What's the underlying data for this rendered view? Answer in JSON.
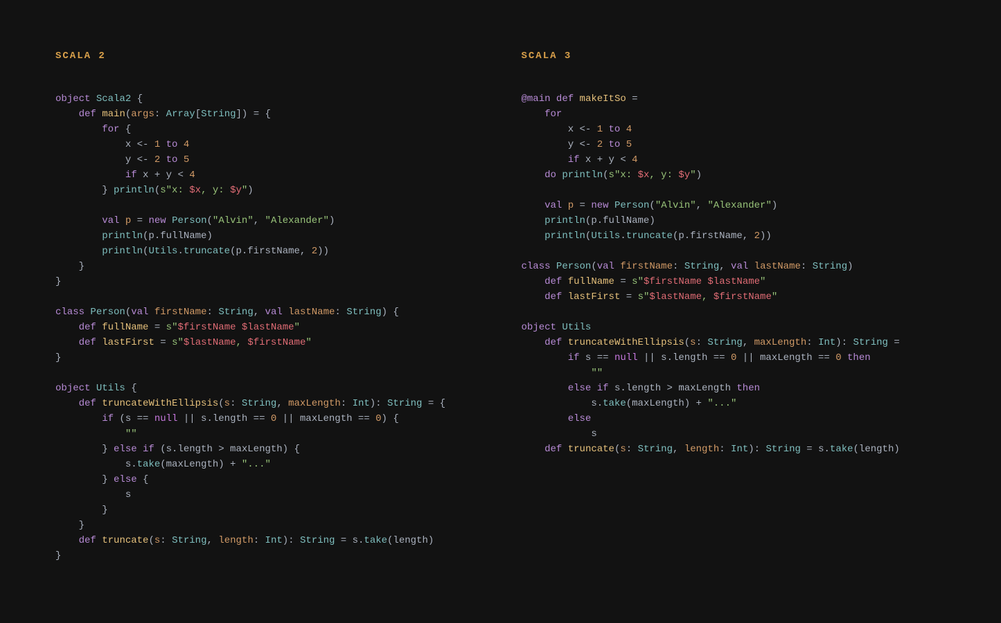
{
  "left": {
    "title": "SCALA 2",
    "tokens": [
      [
        [
          "kw",
          "object"
        ],
        [
          "plain",
          " "
        ],
        [
          "type",
          "Scala2"
        ],
        [
          "plain",
          " {"
        ]
      ],
      [
        [
          "plain",
          "    "
        ],
        [
          "kw",
          "def"
        ],
        [
          "plain",
          " "
        ],
        [
          "fn",
          "main"
        ],
        [
          "plain",
          "("
        ],
        [
          "id",
          "args"
        ],
        [
          "plain",
          ": "
        ],
        [
          "type",
          "Array"
        ],
        [
          "plain",
          "["
        ],
        [
          "type",
          "String"
        ],
        [
          "plain",
          "]) = {"
        ]
      ],
      [
        [
          "plain",
          "        "
        ],
        [
          "kw",
          "for"
        ],
        [
          "plain",
          " {"
        ]
      ],
      [
        [
          "plain",
          "            "
        ],
        [
          "plain",
          "x <- "
        ],
        [
          "num",
          "1"
        ],
        [
          "plain",
          " "
        ],
        [
          "kw",
          "to"
        ],
        [
          "plain",
          " "
        ],
        [
          "num",
          "4"
        ]
      ],
      [
        [
          "plain",
          "            "
        ],
        [
          "plain",
          "y <- "
        ],
        [
          "num",
          "2"
        ],
        [
          "plain",
          " "
        ],
        [
          "kw",
          "to"
        ],
        [
          "plain",
          " "
        ],
        [
          "num",
          "5"
        ]
      ],
      [
        [
          "plain",
          "            "
        ],
        [
          "kw",
          "if"
        ],
        [
          "plain",
          " x + y < "
        ],
        [
          "num",
          "4"
        ]
      ],
      [
        [
          "plain",
          "        } "
        ],
        [
          "call",
          "println"
        ],
        [
          "plain",
          "("
        ],
        [
          "str",
          "s\"x: "
        ],
        [
          "interp",
          "$x"
        ],
        [
          "str",
          ", y: "
        ],
        [
          "interp",
          "$y"
        ],
        [
          "str",
          "\""
        ],
        [
          "plain",
          ")"
        ]
      ],
      [
        [
          "plain",
          ""
        ]
      ],
      [
        [
          "plain",
          "        "
        ],
        [
          "kw",
          "val"
        ],
        [
          "plain",
          " "
        ],
        [
          "id",
          "p"
        ],
        [
          "plain",
          " = "
        ],
        [
          "kw",
          "new"
        ],
        [
          "plain",
          " "
        ],
        [
          "type",
          "Person"
        ],
        [
          "plain",
          "("
        ],
        [
          "str",
          "\"Alvin\""
        ],
        [
          "plain",
          ", "
        ],
        [
          "str",
          "\"Alexander\""
        ],
        [
          "plain",
          ")"
        ]
      ],
      [
        [
          "plain",
          "        "
        ],
        [
          "call",
          "println"
        ],
        [
          "plain",
          "(p.fullName)"
        ]
      ],
      [
        [
          "plain",
          "        "
        ],
        [
          "call",
          "println"
        ],
        [
          "plain",
          "("
        ],
        [
          "type",
          "Utils"
        ],
        [
          "plain",
          "."
        ],
        [
          "call",
          "truncate"
        ],
        [
          "plain",
          "(p.firstName, "
        ],
        [
          "num",
          "2"
        ],
        [
          "plain",
          "))"
        ]
      ],
      [
        [
          "plain",
          "    }"
        ]
      ],
      [
        [
          "plain",
          "}"
        ]
      ],
      [
        [
          "plain",
          ""
        ]
      ],
      [
        [
          "kw",
          "class"
        ],
        [
          "plain",
          " "
        ],
        [
          "type",
          "Person"
        ],
        [
          "plain",
          "("
        ],
        [
          "kw",
          "val"
        ],
        [
          "plain",
          " "
        ],
        [
          "id",
          "firstName"
        ],
        [
          "plain",
          ": "
        ],
        [
          "type",
          "String"
        ],
        [
          "plain",
          ", "
        ],
        [
          "kw",
          "val"
        ],
        [
          "plain",
          " "
        ],
        [
          "id",
          "lastName"
        ],
        [
          "plain",
          ": "
        ],
        [
          "type",
          "String"
        ],
        [
          "plain",
          ") {"
        ]
      ],
      [
        [
          "plain",
          "    "
        ],
        [
          "kw",
          "def"
        ],
        [
          "plain",
          " "
        ],
        [
          "fn",
          "fullName"
        ],
        [
          "plain",
          " = "
        ],
        [
          "str",
          "s\""
        ],
        [
          "interp",
          "$firstName"
        ],
        [
          "str",
          " "
        ],
        [
          "interp",
          "$lastName"
        ],
        [
          "str",
          "\""
        ]
      ],
      [
        [
          "plain",
          "    "
        ],
        [
          "kw",
          "def"
        ],
        [
          "plain",
          " "
        ],
        [
          "fn",
          "lastFirst"
        ],
        [
          "plain",
          " = "
        ],
        [
          "str",
          "s\""
        ],
        [
          "interp",
          "$lastName"
        ],
        [
          "str",
          ", "
        ],
        [
          "interp",
          "$firstName"
        ],
        [
          "str",
          "\""
        ]
      ],
      [
        [
          "plain",
          "}"
        ]
      ],
      [
        [
          "plain",
          ""
        ]
      ],
      [
        [
          "kw",
          "object"
        ],
        [
          "plain",
          " "
        ],
        [
          "type",
          "Utils"
        ],
        [
          "plain",
          " {"
        ]
      ],
      [
        [
          "plain",
          "    "
        ],
        [
          "kw",
          "def"
        ],
        [
          "plain",
          " "
        ],
        [
          "fn",
          "truncateWithEllipsis"
        ],
        [
          "plain",
          "("
        ],
        [
          "id",
          "s"
        ],
        [
          "plain",
          ": "
        ],
        [
          "type",
          "String"
        ],
        [
          "plain",
          ", "
        ],
        [
          "id",
          "maxLength"
        ],
        [
          "plain",
          ": "
        ],
        [
          "type",
          "Int"
        ],
        [
          "plain",
          "): "
        ],
        [
          "type",
          "String"
        ],
        [
          "plain",
          " = {"
        ]
      ],
      [
        [
          "plain",
          "        "
        ],
        [
          "kw",
          "if"
        ],
        [
          "plain",
          " (s == "
        ],
        [
          "nl",
          "null"
        ],
        [
          "plain",
          " || s.length == "
        ],
        [
          "num",
          "0"
        ],
        [
          "plain",
          " || maxLength == "
        ],
        [
          "num",
          "0"
        ],
        [
          "plain",
          ") {"
        ]
      ],
      [
        [
          "plain",
          "            "
        ],
        [
          "str",
          "\"\""
        ]
      ],
      [
        [
          "plain",
          "        } "
        ],
        [
          "kw",
          "else"
        ],
        [
          "plain",
          " "
        ],
        [
          "kw",
          "if"
        ],
        [
          "plain",
          " (s.length > maxLength) {"
        ]
      ],
      [
        [
          "plain",
          "            s."
        ],
        [
          "call",
          "take"
        ],
        [
          "plain",
          "(maxLength) + "
        ],
        [
          "str",
          "\"...\""
        ]
      ],
      [
        [
          "plain",
          "        } "
        ],
        [
          "kw",
          "else"
        ],
        [
          "plain",
          " {"
        ]
      ],
      [
        [
          "plain",
          "            s"
        ]
      ],
      [
        [
          "plain",
          "        }"
        ]
      ],
      [
        [
          "plain",
          "    }"
        ]
      ],
      [
        [
          "plain",
          "    "
        ],
        [
          "kw",
          "def"
        ],
        [
          "plain",
          " "
        ],
        [
          "fn",
          "truncate"
        ],
        [
          "plain",
          "("
        ],
        [
          "id",
          "s"
        ],
        [
          "plain",
          ": "
        ],
        [
          "type",
          "String"
        ],
        [
          "plain",
          ", "
        ],
        [
          "id",
          "length"
        ],
        [
          "plain",
          ": "
        ],
        [
          "type",
          "Int"
        ],
        [
          "plain",
          "): "
        ],
        [
          "type",
          "String"
        ],
        [
          "plain",
          " = s."
        ],
        [
          "call",
          "take"
        ],
        [
          "plain",
          "(length)"
        ]
      ],
      [
        [
          "plain",
          "}"
        ]
      ]
    ]
  },
  "right": {
    "title": "SCALA 3",
    "tokens": [
      [
        [
          "kw",
          "@main"
        ],
        [
          "plain",
          " "
        ],
        [
          "kw",
          "def"
        ],
        [
          "plain",
          " "
        ],
        [
          "fn",
          "makeItSo"
        ],
        [
          "plain",
          " ="
        ]
      ],
      [
        [
          "plain",
          "    "
        ],
        [
          "kw",
          "for"
        ]
      ],
      [
        [
          "plain",
          "        x <- "
        ],
        [
          "num",
          "1"
        ],
        [
          "plain",
          " "
        ],
        [
          "kw",
          "to"
        ],
        [
          "plain",
          " "
        ],
        [
          "num",
          "4"
        ]
      ],
      [
        [
          "plain",
          "        y <- "
        ],
        [
          "num",
          "2"
        ],
        [
          "plain",
          " "
        ],
        [
          "kw",
          "to"
        ],
        [
          "plain",
          " "
        ],
        [
          "num",
          "5"
        ]
      ],
      [
        [
          "plain",
          "        "
        ],
        [
          "kw",
          "if"
        ],
        [
          "plain",
          " x + y < "
        ],
        [
          "num",
          "4"
        ]
      ],
      [
        [
          "plain",
          "    "
        ],
        [
          "kw",
          "do"
        ],
        [
          "plain",
          " "
        ],
        [
          "call",
          "println"
        ],
        [
          "plain",
          "("
        ],
        [
          "str",
          "s\"x: "
        ],
        [
          "interp",
          "$x"
        ],
        [
          "str",
          ", y: "
        ],
        [
          "interp",
          "$y"
        ],
        [
          "str",
          "\""
        ],
        [
          "plain",
          ")"
        ]
      ],
      [
        [
          "plain",
          ""
        ]
      ],
      [
        [
          "plain",
          "    "
        ],
        [
          "kw",
          "val"
        ],
        [
          "plain",
          " "
        ],
        [
          "id",
          "p"
        ],
        [
          "plain",
          " = "
        ],
        [
          "kw",
          "new"
        ],
        [
          "plain",
          " "
        ],
        [
          "type",
          "Person"
        ],
        [
          "plain",
          "("
        ],
        [
          "str",
          "\"Alvin\""
        ],
        [
          "plain",
          ", "
        ],
        [
          "str",
          "\"Alexander\""
        ],
        [
          "plain",
          ")"
        ]
      ],
      [
        [
          "plain",
          "    "
        ],
        [
          "call",
          "println"
        ],
        [
          "plain",
          "(p.fullName)"
        ]
      ],
      [
        [
          "plain",
          "    "
        ],
        [
          "call",
          "println"
        ],
        [
          "plain",
          "("
        ],
        [
          "type",
          "Utils"
        ],
        [
          "plain",
          "."
        ],
        [
          "call",
          "truncate"
        ],
        [
          "plain",
          "(p.firstName, "
        ],
        [
          "num",
          "2"
        ],
        [
          "plain",
          "))"
        ]
      ],
      [
        [
          "plain",
          ""
        ]
      ],
      [
        [
          "kw",
          "class"
        ],
        [
          "plain",
          " "
        ],
        [
          "type",
          "Person"
        ],
        [
          "plain",
          "("
        ],
        [
          "kw",
          "val"
        ],
        [
          "plain",
          " "
        ],
        [
          "id",
          "firstName"
        ],
        [
          "plain",
          ": "
        ],
        [
          "type",
          "String"
        ],
        [
          "plain",
          ", "
        ],
        [
          "kw",
          "val"
        ],
        [
          "plain",
          " "
        ],
        [
          "id",
          "lastName"
        ],
        [
          "plain",
          ": "
        ],
        [
          "type",
          "String"
        ],
        [
          "plain",
          ")"
        ]
      ],
      [
        [
          "plain",
          "    "
        ],
        [
          "kw",
          "def"
        ],
        [
          "plain",
          " "
        ],
        [
          "fn",
          "fullName"
        ],
        [
          "plain",
          " = "
        ],
        [
          "str",
          "s\""
        ],
        [
          "interp",
          "$firstName"
        ],
        [
          "str",
          " "
        ],
        [
          "interp",
          "$lastName"
        ],
        [
          "str",
          "\""
        ]
      ],
      [
        [
          "plain",
          "    "
        ],
        [
          "kw",
          "def"
        ],
        [
          "plain",
          " "
        ],
        [
          "fn",
          "lastFirst"
        ],
        [
          "plain",
          " = "
        ],
        [
          "str",
          "s\""
        ],
        [
          "interp",
          "$lastName"
        ],
        [
          "str",
          ", "
        ],
        [
          "interp",
          "$firstName"
        ],
        [
          "str",
          "\""
        ]
      ],
      [
        [
          "plain",
          ""
        ]
      ],
      [
        [
          "kw",
          "object"
        ],
        [
          "plain",
          " "
        ],
        [
          "type",
          "Utils"
        ]
      ],
      [
        [
          "plain",
          "    "
        ],
        [
          "kw",
          "def"
        ],
        [
          "plain",
          " "
        ],
        [
          "fn",
          "truncateWithEllipsis"
        ],
        [
          "plain",
          "("
        ],
        [
          "id",
          "s"
        ],
        [
          "plain",
          ": "
        ],
        [
          "type",
          "String"
        ],
        [
          "plain",
          ", "
        ],
        [
          "id",
          "maxLength"
        ],
        [
          "plain",
          ": "
        ],
        [
          "type",
          "Int"
        ],
        [
          "plain",
          "): "
        ],
        [
          "type",
          "String"
        ],
        [
          "plain",
          " ="
        ]
      ],
      [
        [
          "plain",
          "        "
        ],
        [
          "kw",
          "if"
        ],
        [
          "plain",
          " s == "
        ],
        [
          "nl",
          "null"
        ],
        [
          "plain",
          " || s.length == "
        ],
        [
          "num",
          "0"
        ],
        [
          "plain",
          " || maxLength == "
        ],
        [
          "num",
          "0"
        ],
        [
          "plain",
          " "
        ],
        [
          "kw",
          "then"
        ]
      ],
      [
        [
          "plain",
          "            "
        ],
        [
          "str",
          "\"\""
        ]
      ],
      [
        [
          "plain",
          "        "
        ],
        [
          "kw",
          "else"
        ],
        [
          "plain",
          " "
        ],
        [
          "kw",
          "if"
        ],
        [
          "plain",
          " s.length > maxLength "
        ],
        [
          "kw",
          "then"
        ]
      ],
      [
        [
          "plain",
          "            s."
        ],
        [
          "call",
          "take"
        ],
        [
          "plain",
          "(maxLength) + "
        ],
        [
          "str",
          "\"...\""
        ]
      ],
      [
        [
          "plain",
          "        "
        ],
        [
          "kw",
          "else"
        ]
      ],
      [
        [
          "plain",
          "            s"
        ]
      ],
      [
        [
          "plain",
          "    "
        ],
        [
          "kw",
          "def"
        ],
        [
          "plain",
          " "
        ],
        [
          "fn",
          "truncate"
        ],
        [
          "plain",
          "("
        ],
        [
          "id",
          "s"
        ],
        [
          "plain",
          ": "
        ],
        [
          "type",
          "String"
        ],
        [
          "plain",
          ", "
        ],
        [
          "id",
          "length"
        ],
        [
          "plain",
          ": "
        ],
        [
          "type",
          "Int"
        ],
        [
          "plain",
          "): "
        ],
        [
          "type",
          "String"
        ],
        [
          "plain",
          " = s."
        ],
        [
          "call",
          "take"
        ],
        [
          "plain",
          "(length)"
        ]
      ]
    ]
  }
}
